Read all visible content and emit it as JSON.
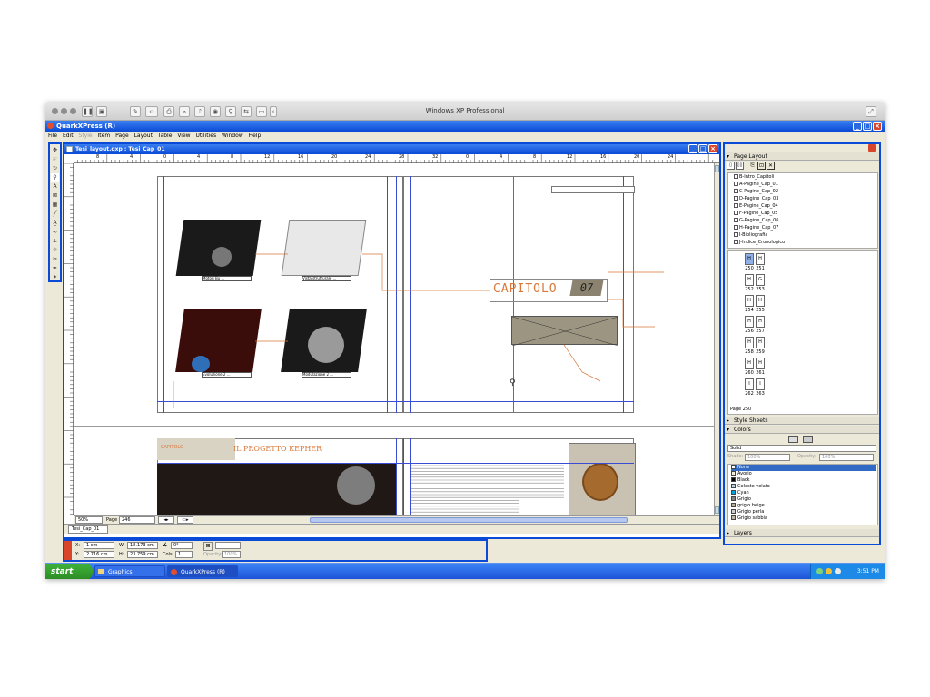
{
  "mac": {
    "title": "Windows XP Professional",
    "toolbar_icons": [
      "pause-icon",
      "snapshot-icon",
      "settings-icon",
      "back-forward-icon",
      "print-icon",
      "usb-icon",
      "sound-icon",
      "camera-icon",
      "lock-icon",
      "share-icon",
      "folder-icon",
      "collapse-icon"
    ]
  },
  "app": {
    "title": "QuarkXPress (R)"
  },
  "menu": {
    "items": [
      "File",
      "Edit",
      "Style",
      "Item",
      "Page",
      "Layout",
      "Table",
      "View",
      "Utilities",
      "Window",
      "Help"
    ]
  },
  "document": {
    "title": "Tesi_layout.qxp : Tesi_Cap_01",
    "ruler_labels": [
      "8",
      "4",
      "0",
      "4",
      "8",
      "12",
      "16",
      "20",
      "24",
      "28",
      "32",
      "0",
      "4",
      "8",
      "12",
      "16",
      "20",
      "24",
      "28",
      "32"
    ],
    "chapter_label": "CAPITOLO",
    "chapter_number": "07",
    "spread_heading": "IL PROGETTO KEPHER",
    "small_caption_left": "CAPITOLO",
    "image_captions": [
      "Motori Bu ...",
      "Vista strutturale ...",
      "Evoluzione 2 ...",
      "Modulazione 2 ..."
    ]
  },
  "statusbar": {
    "zoom": "50%",
    "page_label": "Page",
    "page_value": "246",
    "layout_tab": "Tesi_Cap_01"
  },
  "measurements": {
    "x_label": "X:",
    "x_value": "1 cm",
    "y_label": "Y:",
    "y_value": "2.716 cm",
    "w_label": "W:",
    "w_value": "18.173 cm",
    "h_label": "H:",
    "h_value": "23.759 cm",
    "angle_value": "0°",
    "cols_label": "Cols:",
    "cols_value": "1",
    "opacity_label": "Opacity:",
    "opacity_value": "100%"
  },
  "page_layout": {
    "title": "Page Layout",
    "masters": [
      "B-Intro_Capitoli",
      "A-Pagine_Cap_01",
      "C-Pagine_Cap_02",
      "D-Pagine_Cap_03",
      "E-Pagine_Cap_04",
      "F-Pagine_Cap_05",
      "G-Pagine_Cap_06",
      "H-Pagine_Cap_07",
      "I-Bibliografia",
      "J-Indice_Cronologico"
    ],
    "pages": [
      {
        "l": "H",
        "r": "H",
        "ln": "250",
        "rn": "251"
      },
      {
        "l": "H",
        "r": "G",
        "ln": "252",
        "rn": "253"
      },
      {
        "l": "H",
        "r": "H",
        "ln": "254",
        "rn": "255"
      },
      {
        "l": "H",
        "r": "H",
        "ln": "256",
        "rn": "257"
      },
      {
        "l": "H",
        "r": "H",
        "ln": "258",
        "rn": "259"
      },
      {
        "l": "H",
        "r": "H",
        "ln": "260",
        "rn": "261"
      },
      {
        "l": "I",
        "r": "I",
        "ln": "262",
        "rn": "263"
      }
    ],
    "footer": "Page 250"
  },
  "style_sheets": {
    "title": "Style Sheets"
  },
  "colors": {
    "title": "Colors",
    "mode": "Solid",
    "shade_label": "Shade:",
    "shade_value": "100%",
    "opacity_label": "Opacity:",
    "opacity_value": "100%",
    "items": [
      {
        "name": "None",
        "hex": "#ffffff",
        "selected": true
      },
      {
        "name": "Avorio",
        "hex": "#f3eddc"
      },
      {
        "name": "Black",
        "hex": "#000000"
      },
      {
        "name": "Celeste velato",
        "hex": "#b9d3e6"
      },
      {
        "name": "Cyan",
        "hex": "#00a3e0"
      },
      {
        "name": "Grigio",
        "hex": "#808080"
      },
      {
        "name": "grigio beige",
        "hex": "#b7ae9c"
      },
      {
        "name": "Grigio perla",
        "hex": "#cfcfcf"
      },
      {
        "name": "Grigio sabbia",
        "hex": "#bfb6a4"
      }
    ]
  },
  "layers": {
    "title": "Layers"
  },
  "taskbar": {
    "start": "start",
    "tasks": [
      "Graphics",
      "QuarkXPress (R)"
    ],
    "time": "3:51 PM"
  },
  "accent": {
    "xp_blue": "#0a4ad6",
    "guide": "#3a4bd6",
    "orange": "#d9783a"
  }
}
